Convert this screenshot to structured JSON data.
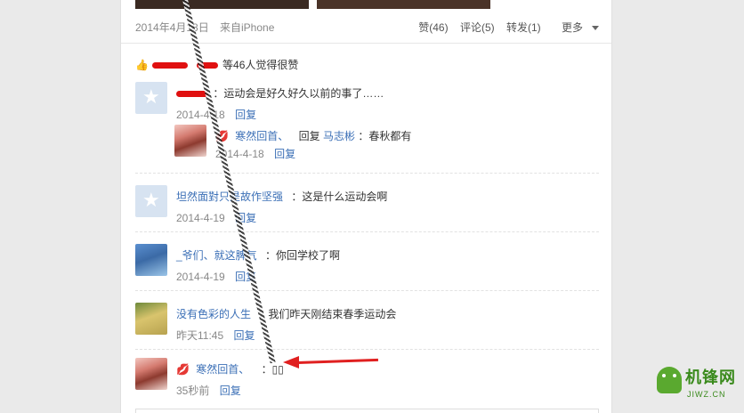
{
  "post": {
    "date": "2014年4月18日",
    "source": "来自iPhone",
    "like_label": "赞(46)",
    "comment_label": "评论(5)",
    "repost_label": "转发(1)",
    "more_label": "更多"
  },
  "likes_summary": {
    "text": "等46人觉得很赞"
  },
  "comments": [
    {
      "user": "",
      "text": "：运动会是好久好久以前的事了……",
      "time": "2014-4-18",
      "reply": "回复",
      "avatar": "default-avatar"
    },
    {
      "user": "寒然回首、",
      "reply_prefix": "回复",
      "reply_to": "马志彬",
      "text": "：春秋都有",
      "time": "2014-4-18",
      "reply": "回复",
      "avatar": "anime-avatar"
    },
    {
      "user": "坦然面對只是故作坚强",
      "text": "：这是什么运动会啊",
      "time": "2014-4-19",
      "reply": "回复",
      "avatar": "default-avatar"
    },
    {
      "user": "_爷们、就这脾气",
      "text": "：你回学校了啊",
      "time": "2014-4-19",
      "reply": "回复",
      "avatar": "photo-avatar"
    },
    {
      "user": "没有色彩的人生",
      "text": "：我们昨天刚结束春季运动会",
      "time": "昨天11:45",
      "reply": "回复",
      "avatar": "nature-avatar"
    },
    {
      "user": "寒然回首、",
      "text": "：▯▯",
      "time": "35秒前",
      "reply": "回复",
      "avatar": "anime-avatar"
    }
  ],
  "watermark": {
    "brand": "机锋网",
    "site": "JIWZ.CN"
  },
  "icons": {
    "thumb": "thumbs-up-icon",
    "caret": "caret-down-icon",
    "kiss": "lips-icon"
  },
  "colors": {
    "link": "#3b6fb6",
    "annotation_red": "#e02020"
  }
}
